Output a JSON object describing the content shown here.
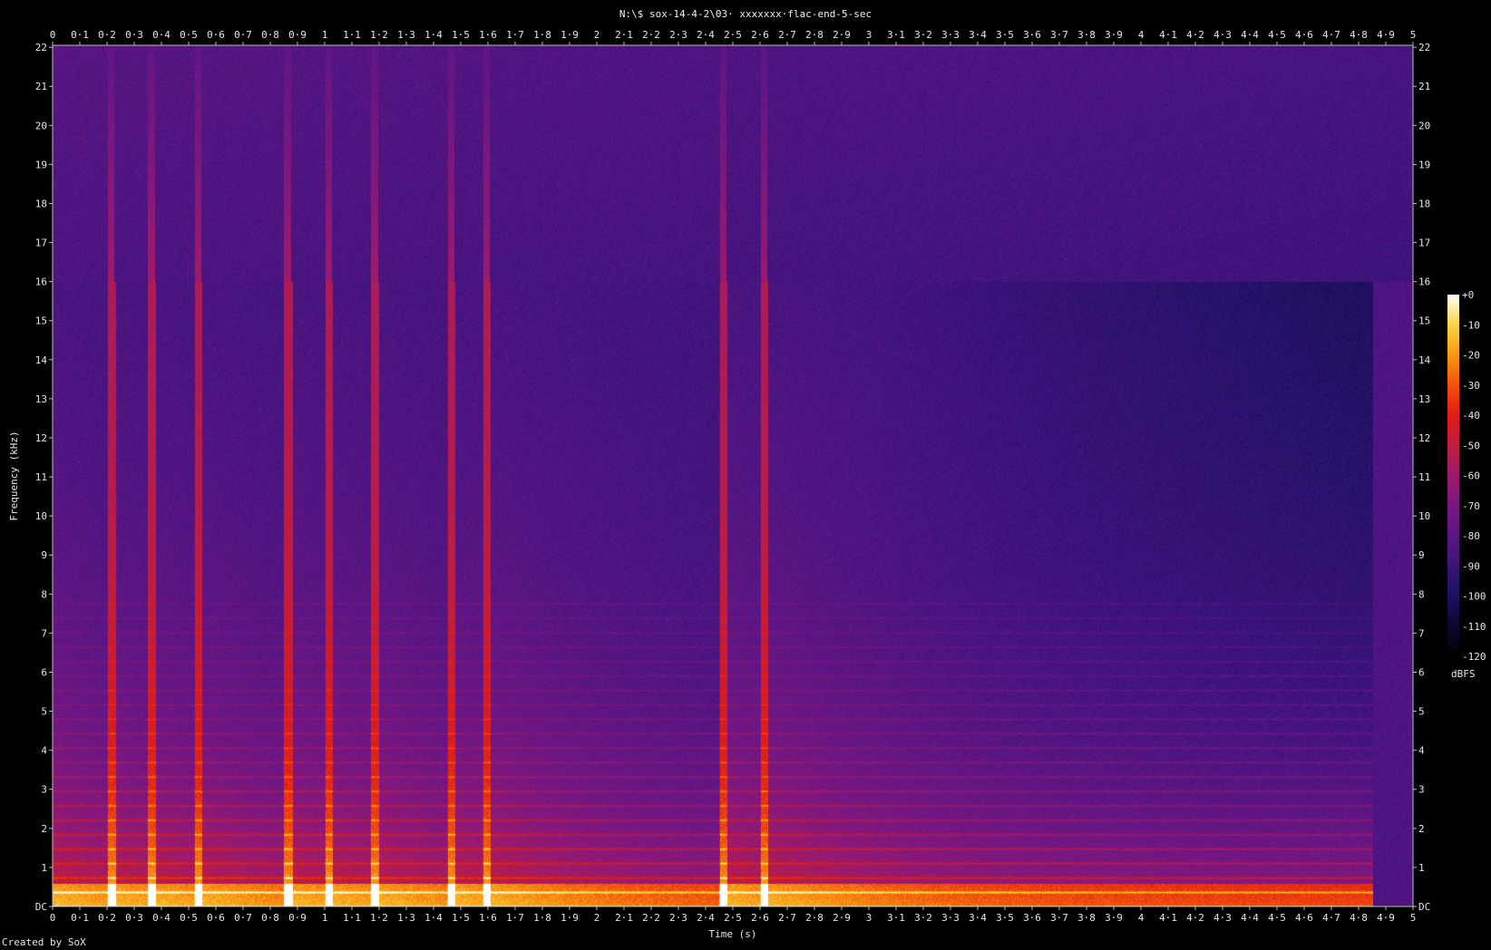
{
  "title": "N:\\$ sox-14-4-2\\03· xxxxxxx·flac-end-5-sec",
  "credit": "Created by SoX",
  "colors": {
    "background": "#000000",
    "axis": "#cccccc",
    "palette": [
      "#000000",
      "#0a0830",
      "#1c1160",
      "#3a137a",
      "#5c1684",
      "#7a1781",
      "#9b1a6e",
      "#c01d3e",
      "#e21c16",
      "#f2500c",
      "#f89a12",
      "#fad545",
      "#ffffff"
    ]
  },
  "chart_data": {
    "type": "heatmap",
    "subtype": "spectrogram",
    "xlabel": "Time (s)",
    "ylabel": "Frequency (kHz)",
    "xlim": [
      0,
      5
    ],
    "ylim": [
      0,
      22.05
    ],
    "x_ticks": [
      "0",
      "0·1",
      "0·2",
      "0·3",
      "0·4",
      "0·5",
      "0·6",
      "0·7",
      "0·8",
      "0·9",
      "1",
      "1·1",
      "1·2",
      "1·3",
      "1·4",
      "1·5",
      "1·6",
      "1·7",
      "1·8",
      "1·9",
      "2",
      "2·1",
      "2·2",
      "2·3",
      "2·4",
      "2·5",
      "2·6",
      "2·7",
      "2·8",
      "2·9",
      "3",
      "3·1",
      "3·2",
      "3·3",
      "3·4",
      "3·5",
      "3·6",
      "3·7",
      "3·8",
      "3·9",
      "4",
      "4·1",
      "4·2",
      "4·3",
      "4·4",
      "4·5",
      "4·6",
      "4·7",
      "4·8",
      "4·9",
      "5"
    ],
    "y_ticks": [
      "DC",
      "1",
      "2",
      "3",
      "4",
      "5",
      "6",
      "7",
      "8",
      "9",
      "10",
      "11",
      "12",
      "13",
      "14",
      "15",
      "16",
      "17",
      "18",
      "19",
      "20",
      "21",
      "22"
    ],
    "colorbar": {
      "label": "dBFS",
      "range": [
        -120,
        0
      ],
      "ticks": [
        "+0",
        "-10",
        "-20",
        "-30",
        "-40",
        "-50",
        "-60",
        "-70",
        "-80",
        "-90",
        "-100",
        "-110",
        "-120"
      ]
    },
    "lowpass_cutoff_khz": 16,
    "onsets_s": [
      0.2,
      0.35,
      0.52,
      0.85,
      1.0,
      1.17,
      1.45,
      1.58,
      2.45,
      2.6
    ],
    "decay_end_s": 4.85
  }
}
